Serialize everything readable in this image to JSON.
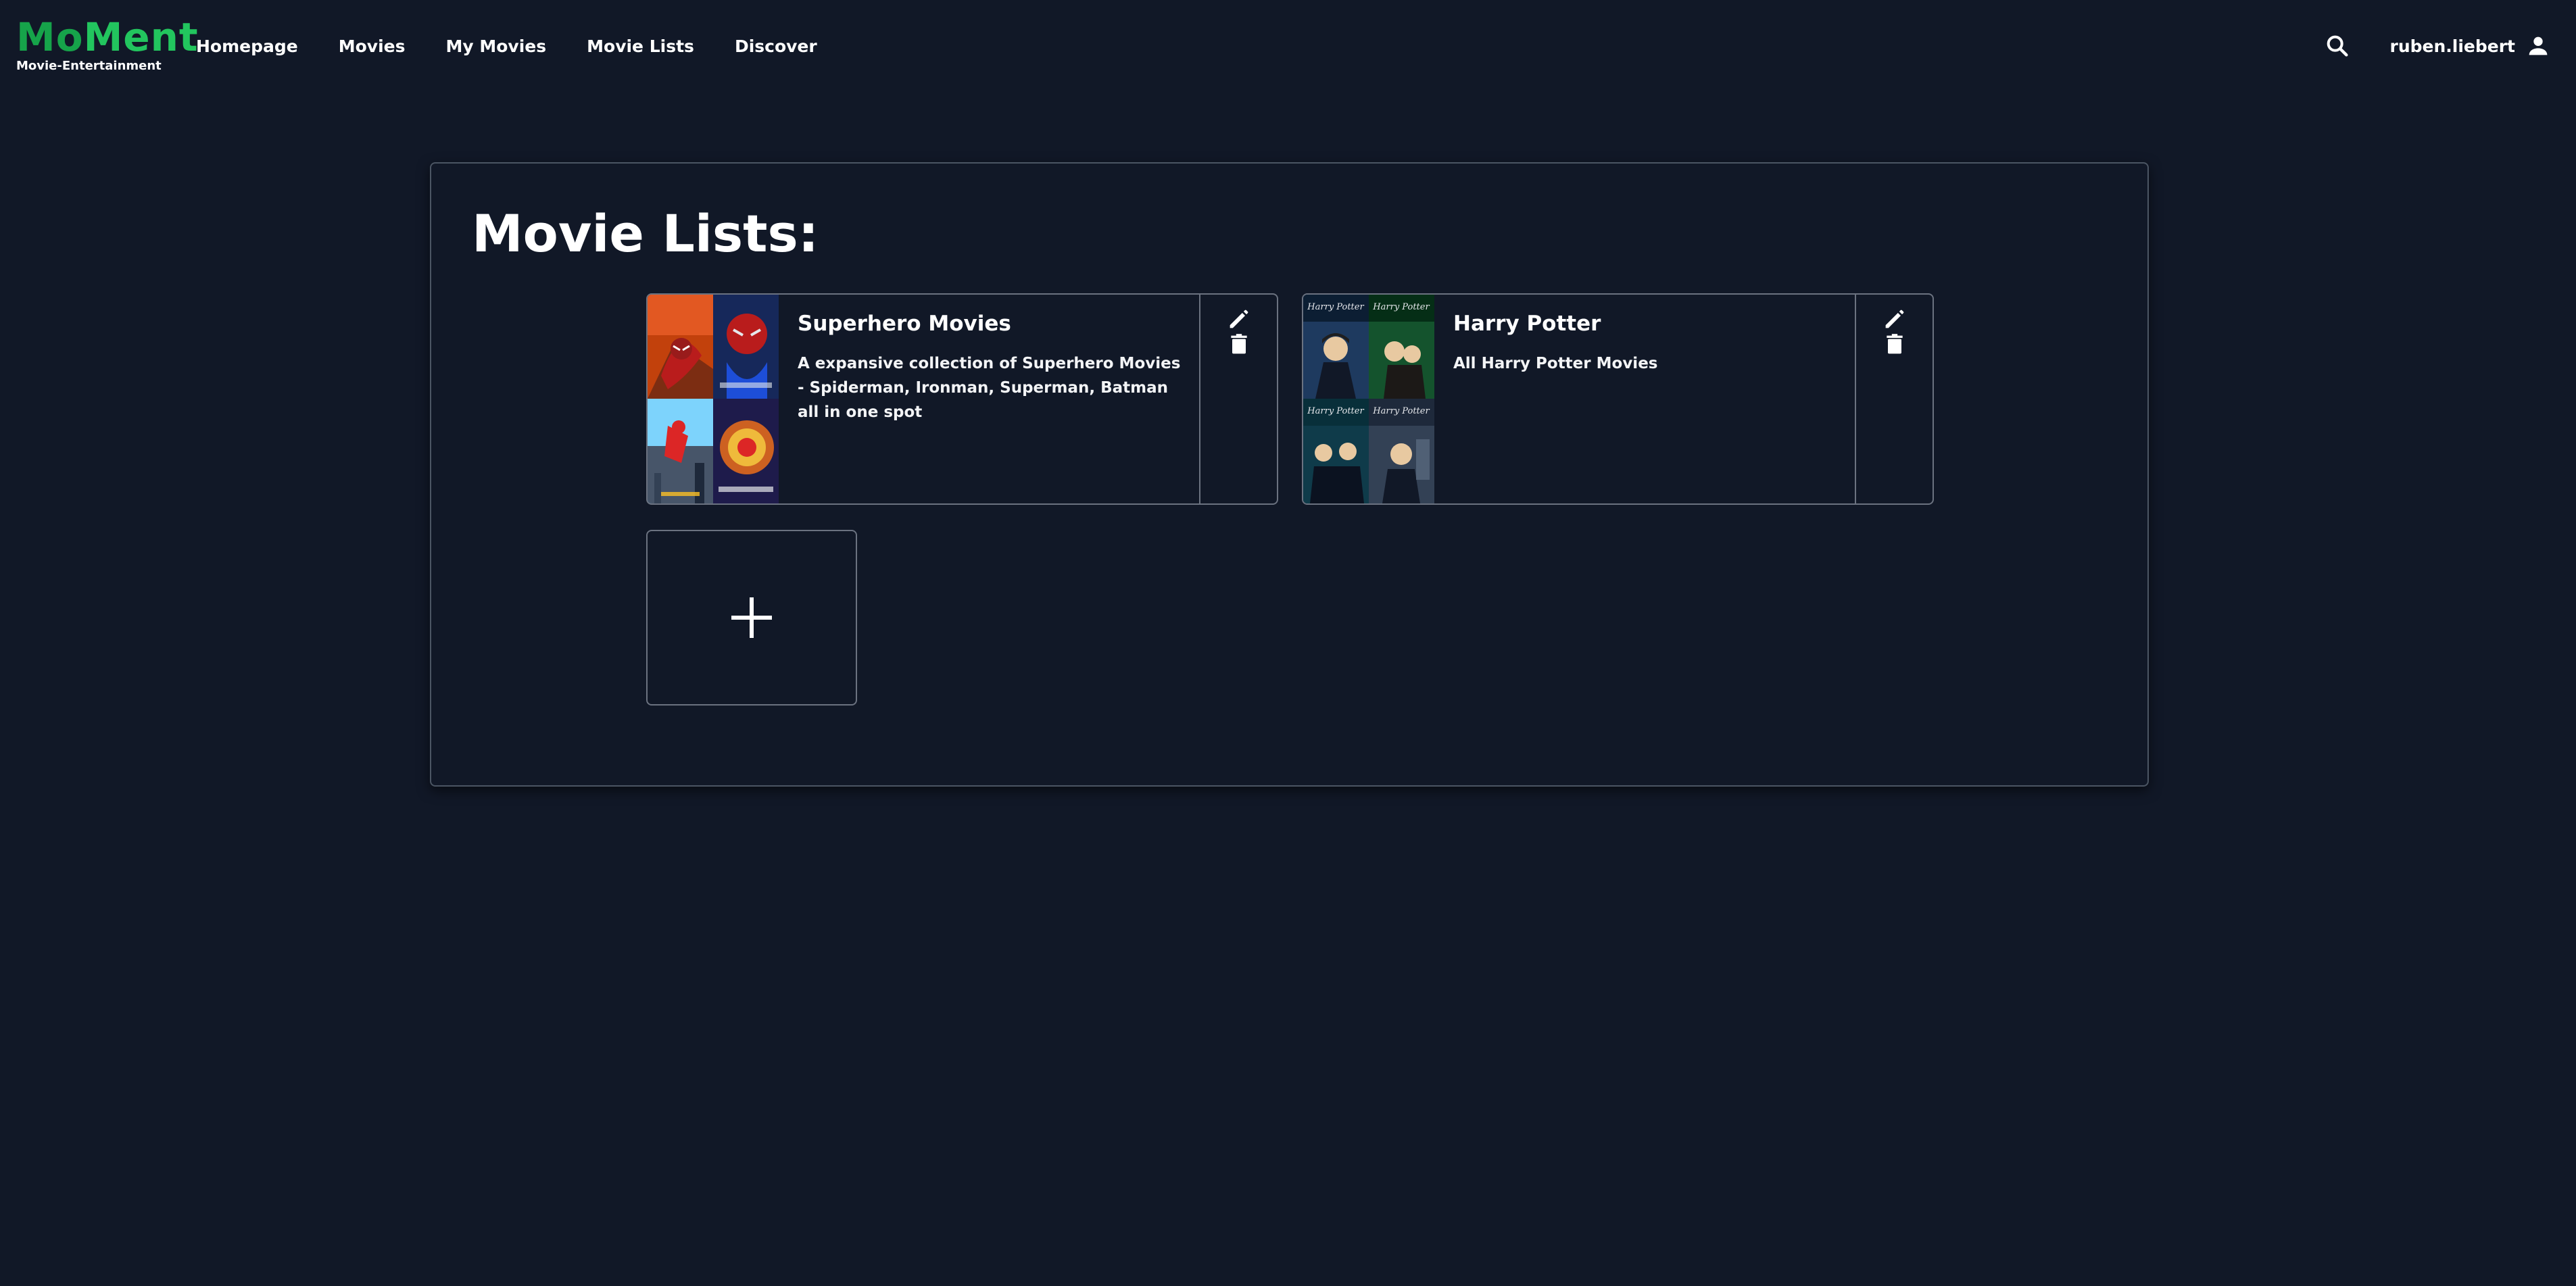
{
  "brand": {
    "name_part1": "Mo",
    "name_part2": "Ment",
    "subtitle": "Movie-Entertainment"
  },
  "nav": {
    "links": [
      "Homepage",
      "Movies",
      "My Movies",
      "Movie Lists",
      "Discover"
    ],
    "username": "ruben.liebert"
  },
  "page": {
    "title": "Movie Lists:"
  },
  "lists": [
    {
      "title": "Superhero Movies",
      "description": "A expansive collection of Superhero Movies - Spiderman, Ironman, Superman, Batman all in one spot",
      "posters": [
        "spiderman-poster-1",
        "spiderman-poster-2",
        "spiderman-poster-3",
        "spiderman-poster-4"
      ]
    },
    {
      "title": "Harry Potter",
      "description": "All Harry Potter Movies",
      "posters": [
        "harry-potter-poster-1",
        "harry-potter-poster-2",
        "harry-potter-poster-3",
        "harry-potter-poster-4"
      ]
    }
  ],
  "colors": {
    "background": "#111827",
    "brand_green": "#22c55e",
    "border": "#6b7280"
  },
  "icons": {
    "search": "search-icon",
    "user": "user-icon",
    "edit": "pencil-icon",
    "delete": "trash-icon",
    "add": "plus-icon"
  }
}
